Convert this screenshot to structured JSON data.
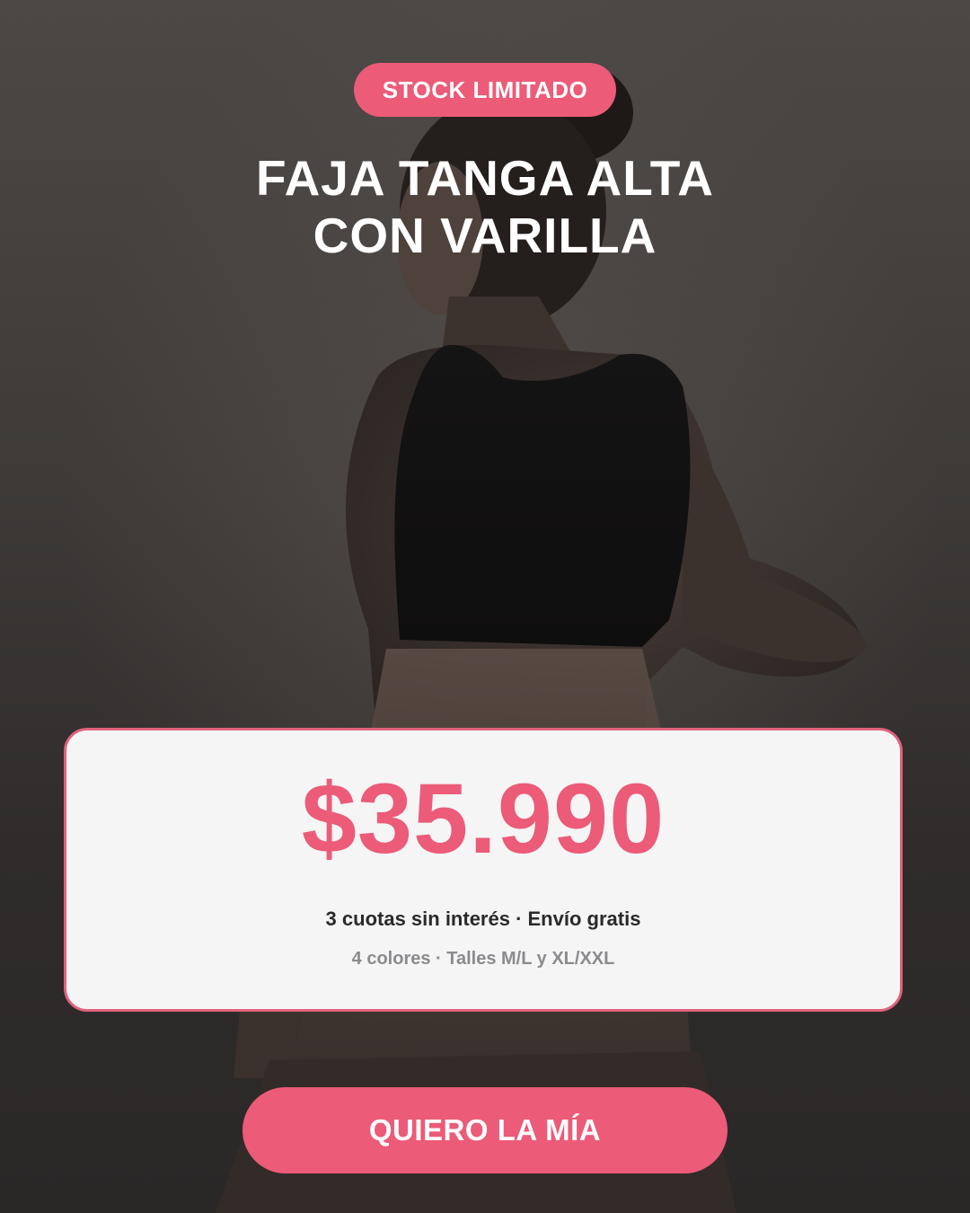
{
  "badge": {
    "label": "STOCK LIMITADO"
  },
  "title": {
    "line1": "FAJA TANGA ALTA",
    "line2": "CON VARILLA"
  },
  "offer": {
    "price": "$35.990",
    "terms": "3 cuotas sin interés · Envío gratis",
    "variants": "4 colores · Talles M/L y XL/XXL"
  },
  "cta": {
    "label": "QUIERO LA MÍA"
  },
  "colors": {
    "accent": "#ec5b78",
    "card_background": "#f5f5f5",
    "background": "#3d3a38"
  }
}
